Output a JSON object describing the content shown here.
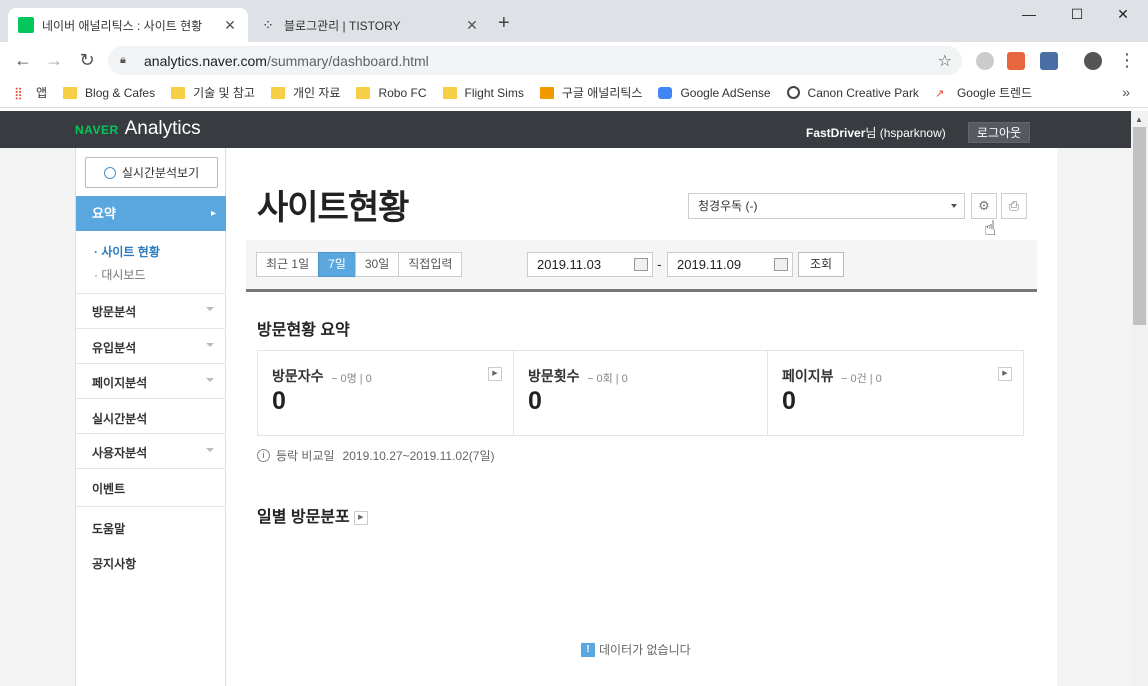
{
  "browser": {
    "tabs": [
      {
        "title": "네이버 애널리틱스 : 사이트 현황",
        "close": "✕"
      },
      {
        "title": "블로그관리 | TISTORY",
        "close": "✕"
      }
    ],
    "new_tab": "+",
    "window_controls": {
      "minimize": "—",
      "maximize": "☐",
      "close": "✕"
    },
    "url_domain": "analytics.naver.com",
    "url_path": "/summary/dashboard.html",
    "bookmarks": [
      {
        "label": "앱",
        "icon": "apps-icon"
      },
      {
        "label": "Blog & Cafes",
        "icon": "folder-icon"
      },
      {
        "label": "기술 및 참고",
        "icon": "folder-icon"
      },
      {
        "label": "개인 자료",
        "icon": "folder-icon"
      },
      {
        "label": "Robo FC",
        "icon": "folder-icon"
      },
      {
        "label": "Flight Sims",
        "icon": "folder-icon"
      },
      {
        "label": "구글 애널리틱스",
        "icon": "analytics-icon"
      },
      {
        "label": "Google AdSense",
        "icon": "adsense-icon"
      },
      {
        "label": "Canon Creative Park",
        "icon": "globe-icon"
      },
      {
        "label": "Google 트렌드",
        "icon": "trends-icon"
      }
    ],
    "bookmarks_more": "»"
  },
  "header": {
    "logo_naver": "NAVER",
    "logo_analytics": "Analytics",
    "user_name": "FastDriver",
    "user_suffix": "님 (hsparknow)",
    "logout_label": "로그아웃"
  },
  "sidebar": {
    "realtime_button": "실시간분석보기",
    "summary_label": "요약",
    "summary_arrow": "▸",
    "submenu": [
      {
        "label": "· 사이트 현황",
        "active": true
      },
      {
        "label": "· 대시보드",
        "active": false
      }
    ],
    "menu": [
      {
        "label": "방문분석",
        "has_caret": true
      },
      {
        "label": "유입분석",
        "has_caret": true
      },
      {
        "label": "페이지분석",
        "has_caret": true
      },
      {
        "label": "실시간분석",
        "has_caret": false
      },
      {
        "label": "사용자분석",
        "has_caret": true
      },
      {
        "label": "이벤트",
        "has_caret": false
      },
      {
        "label": "도움말",
        "has_caret": false
      },
      {
        "label": "공지사항",
        "has_caret": false
      }
    ]
  },
  "main": {
    "title": "사이트현황",
    "site_select_value": "청경우독 (-)",
    "period_buttons": [
      "최근 1일",
      "7일",
      "30일",
      "직접입력"
    ],
    "period_selected": "7일",
    "date_start": "2019.11.03",
    "date_end": "2019.11.09",
    "date_dash": "-",
    "search_button": "조회",
    "summary_title": "방문현황 요약",
    "stats": [
      {
        "label": "방문자수",
        "sub": "− 0명 | 0",
        "value": "0"
      },
      {
        "label": "방문횟수",
        "sub": "− 0회 | 0",
        "value": "0"
      },
      {
        "label": "페이지뷰",
        "sub": "− 0건 | 0",
        "value": "0"
      }
    ],
    "compare_label": "등락 비교일",
    "compare_range": "2019.10.27~2019.11.02(7일)",
    "daily_title": "일별 방문분포",
    "no_data": "데이터가 없습니다"
  },
  "colors": {
    "naver_green": "#03c75a",
    "accent_blue": "#5aa7e0",
    "header_dark": "#383b40"
  }
}
